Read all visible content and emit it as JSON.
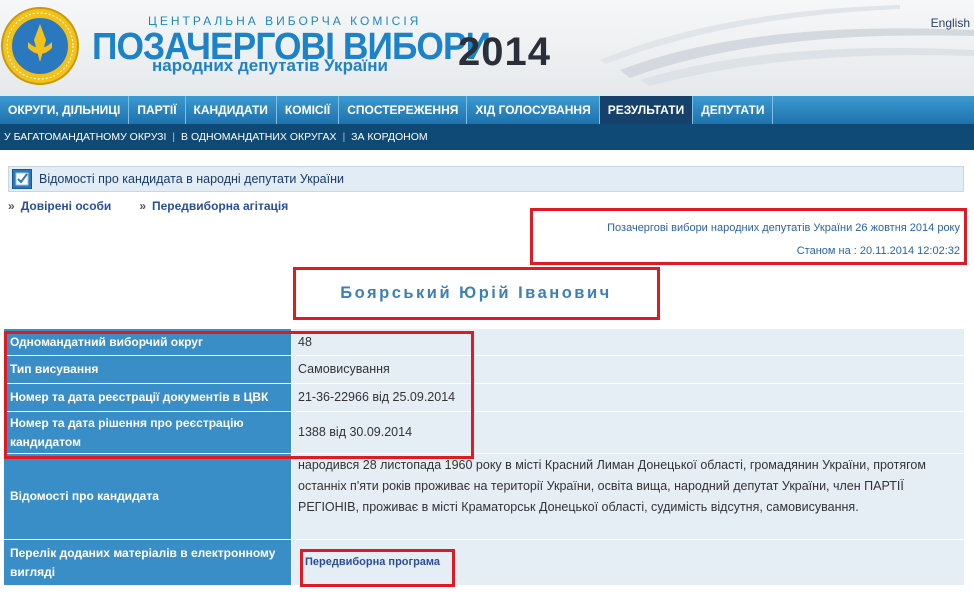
{
  "header": {
    "org_name": "ЦЕНТРАЛЬНА ВИБОРЧА КОМІСІЯ",
    "title_main": "ПОЗАЧЕРГОВІ ВИБОРИ",
    "title_sub": "народних депутатів України",
    "year": "2014",
    "lang_link": "English"
  },
  "main_nav": [
    {
      "label": "ОКРУГИ, ДІЛЬНИЦІ",
      "active": false
    },
    {
      "label": "ПАРТІЇ",
      "active": false
    },
    {
      "label": "КАНДИДАТИ",
      "active": false
    },
    {
      "label": "КОМІСІЇ",
      "active": false
    },
    {
      "label": "СПОСТЕРЕЖЕННЯ",
      "active": false
    },
    {
      "label": "ХІД ГОЛОСУВАННЯ",
      "active": false
    },
    {
      "label": "РЕЗУЛЬТАТИ",
      "active": true
    },
    {
      "label": "ДЕПУТАТИ",
      "active": false
    }
  ],
  "sub_nav": [
    "У БАГАТОМАНДАТНОМУ ОКРУЗІ",
    "В ОДНОМАНДАТНИХ ОКРУГАХ",
    "ЗА КОРДОНОМ"
  ],
  "info_header": {
    "icon": "checkbox-icon",
    "title": "Відомості про кандидата в народні депутати України"
  },
  "tabs": {
    "arrow": "»",
    "items": [
      "Довірені особи",
      "Передвиборна агітація"
    ]
  },
  "election": {
    "link": "Позачергові вибори народних депутатів України 26 жовтня 2014 року",
    "status": "Станом на : 20.11.2014 12:02:32"
  },
  "candidate": {
    "name": "Боярський Юрій Іванович"
  },
  "table": {
    "district_label": "Одномандатний виборчий округ",
    "district_value": "48",
    "nomination_label": "Тип висування",
    "nomination_value": "Самовисування",
    "cvk_reg_label": "Номер та дата реєстрації документів в ЦВК",
    "cvk_reg_value": "21-36-22966 від 25.09.2014",
    "decision_label": "Номер та дата рішення про реєстрацію кандидатом",
    "decision_value": "1388 від 30.09.2014",
    "bio_label": "Відомості про кандидата",
    "bio_value": "народився 28 листопада 1960 року в місті Красний Лиман Донецької області, громадянин України, протягом останніх п'яти років проживає на території України, освіта вища, народний депутат України, член ПАРТІЇ РЕГІОНІВ, проживає в місті Краматорськ Донецької області, судимість відсутня, самовисування.",
    "materials_label": "Перелік доданих матеріалів в електронному вигляді",
    "materials_link": "Передвиборна програма"
  },
  "colors": {
    "nav_blue": "#2d86c3",
    "active_tab": "#16416a",
    "label_blue": "#3a8ec7",
    "highlight_red": "#e01a22"
  }
}
